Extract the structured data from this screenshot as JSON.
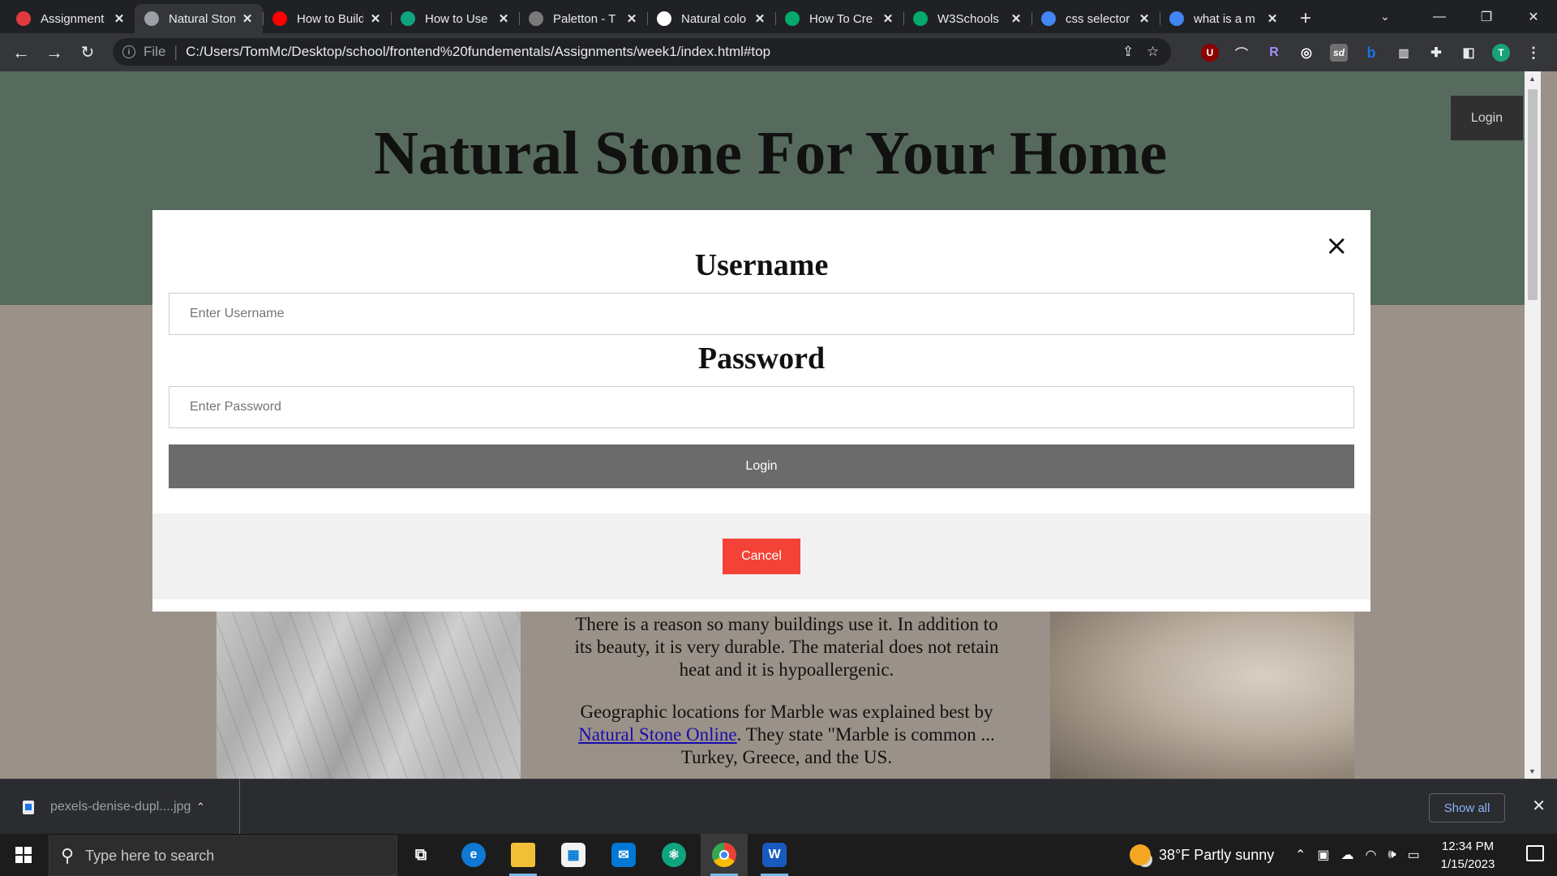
{
  "browser": {
    "tabs": [
      {
        "title": "Assignment",
        "favicon": "canvas-icon",
        "color": "#e0393e",
        "active": false
      },
      {
        "title": "Natural Stone",
        "favicon": "globe-icon",
        "color": "#9aa0a6",
        "active": true
      },
      {
        "title": "How to Build",
        "favicon": "youtube-icon",
        "color": "#ff0000",
        "active": false
      },
      {
        "title": "How to Use",
        "favicon": "hexagon-icon",
        "color": "#10a37f",
        "active": false
      },
      {
        "title": "Paletton - T",
        "favicon": "paletton-icon",
        "color": "#7a7a7a",
        "active": false
      },
      {
        "title": "Natural colo",
        "favicon": "notion-icon",
        "color": "#ffffff",
        "active": false
      },
      {
        "title": "How To Cre",
        "favicon": "w3schools-icon",
        "color": "#04aa6d",
        "active": false
      },
      {
        "title": "W3Schools",
        "favicon": "w3schools-icon",
        "color": "#04aa6d",
        "active": false
      },
      {
        "title": "css selector",
        "favicon": "google-icon",
        "color": "#4285f4",
        "active": false
      },
      {
        "title": "what is a m",
        "favicon": "google-icon",
        "color": "#4285f4",
        "active": false
      }
    ],
    "omnibox": {
      "scheme": "File",
      "url": "C:/Users/TomMc/Desktop/school/frontend%20fundementals/Assignments/week1/index.html#top"
    },
    "profile_initial": "T"
  },
  "page": {
    "hero_title": "Natural Stone For Your Home",
    "login_button": "Login",
    "article": {
      "p1": "There is a reason so many buildings use it. In addition to its beauty, it is very durable. The material does not retain heat and it is hypoallergenic.",
      "p2_before": "Geographic locations for Marble was explained best by",
      "p2_link": "Natural Stone Online",
      "p2_after": ". They state \"Marble is common ... Turkey, Greece, and the US."
    }
  },
  "modal": {
    "username_label": "Username",
    "username_placeholder": "Enter Username",
    "password_label": "Password",
    "password_placeholder": "Enter Password",
    "submit_label": "Login",
    "cancel_label": "Cancel",
    "close_glyph": "×"
  },
  "downloads": {
    "file_name": "pexels-denise-dupl....jpg",
    "show_all": "Show all"
  },
  "taskbar": {
    "search_placeholder": "Type here to search",
    "weather": "38°F  Partly sunny",
    "time": "12:34 PM",
    "date": "1/15/2023"
  },
  "colors": {
    "hero_bg": "#566b5d",
    "body_bg": "#9a9188",
    "submit_bg": "#6b6b6b",
    "cancel_bg": "#f44336"
  }
}
